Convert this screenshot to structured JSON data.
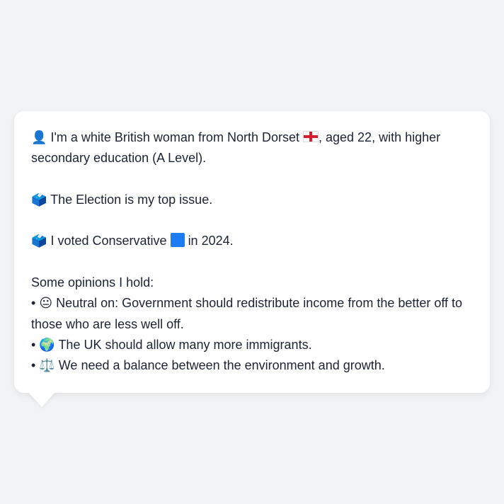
{
  "message": {
    "intro": {
      "person_icon": "👤",
      "text_before_flag": "I'm a white British woman from North Dorset",
      "flag_icon": "england-flag",
      "text_after_flag": ", aged 22, with higher secondary education (A Level)."
    },
    "top_issue": {
      "ballot_icon": "🗳️",
      "text": "The Election is my top issue."
    },
    "vote": {
      "ballot_icon": "🗳️",
      "text_before": "I voted Conservative",
      "party_color": "#1e7cf2",
      "text_after": "in 2024."
    },
    "opinions": {
      "heading": "Some opinions I hold:",
      "bullet": "•",
      "items": [
        {
          "icon": "😐",
          "text": "Neutral on: Government should redistribute income from the better off to those who are less well off."
        },
        {
          "icon": "🌍",
          "text": "The UK should allow many more immigrants."
        },
        {
          "icon": "⚖️",
          "text": "We need a balance between the environment and growth."
        }
      ]
    }
  }
}
